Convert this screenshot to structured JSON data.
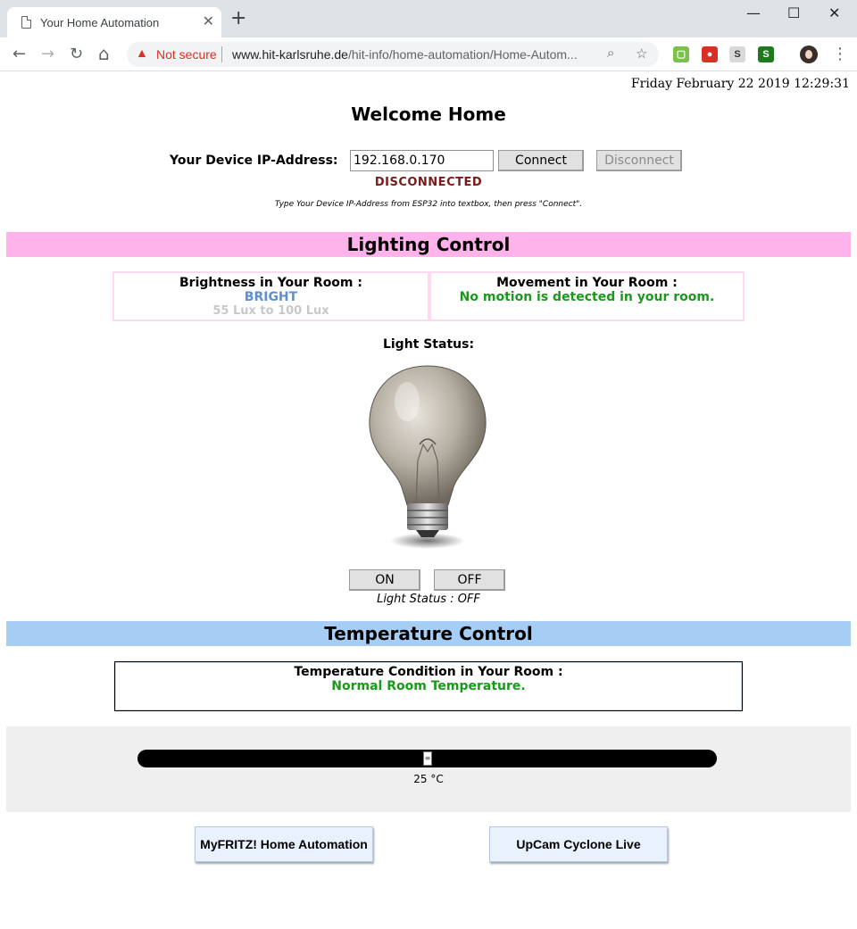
{
  "browser": {
    "tab_title": "Your Home Automation",
    "tab_close": "✕",
    "new_tab": "+",
    "window_controls": {
      "minimize": "—",
      "maximize": "☐",
      "close": "✕"
    },
    "nav": {
      "back": "←",
      "forward": "→",
      "reload": "↻",
      "home": "⌂"
    },
    "security_label": "Not secure",
    "url_host": "www.hit-karlsruhe.de",
    "url_path": "/hit-info/home-automation/Home-Autom...",
    "icons": [
      "search-icon",
      "star-icon",
      "shield-extension-icon",
      "adblock-icon",
      "s-extension-icon",
      "green-s-extension-icon",
      "profile-avatar",
      "menu-dots-icon"
    ]
  },
  "page": {
    "datetime": "Friday February 22 2019 12:29:31",
    "welcome": "Welcome Home",
    "ip_label": "Your Device IP-Address:",
    "ip_value": "192.168.0.170",
    "connect_label": "Connect",
    "disconnect_label": "Disconnect",
    "connection_status": "DISCONNECTED",
    "hint": "Type Your Device IP-Address from ESP32 into textbox, then press \"Connect\".",
    "lighting": {
      "title": "Lighting Control",
      "brightness_title": "Brightness in Your Room :",
      "brightness_value": "BRIGHT",
      "brightness_range": "55 Lux to 100 Lux",
      "movement_title": "Movement in Your Room :",
      "movement_value": "No motion is detected in your room.",
      "light_status_title": "Light Status:",
      "on_label": "ON",
      "off_label": "OFF",
      "light_status_text": "Light Status : OFF"
    },
    "temperature": {
      "title": "Temperature Control",
      "condition_title": "Temperature Condition in Your Room :",
      "condition_value": "Normal Room Temperature.",
      "slider_value": 25,
      "slider_min": 0,
      "slider_max": 50,
      "slider_text": "25 °C"
    },
    "links": {
      "myfritz": "MyFRITZ! Home Automation",
      "upcam": "UpCam Cyclone Live"
    }
  },
  "colors": {
    "lighting_bar": "#ffb3ea",
    "temperature_bar": "#a6cdf3",
    "status_red": "#7a1a1a",
    "ok_green": "#1a9a1a",
    "bright_blue": "#5f8fd6"
  }
}
